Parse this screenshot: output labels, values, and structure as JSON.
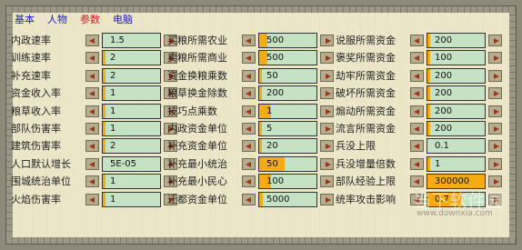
{
  "tabs": [
    {
      "label": "基本",
      "active": false
    },
    {
      "label": "人物",
      "active": false
    },
    {
      "label": "参数",
      "active": true
    },
    {
      "label": "电脑",
      "active": false
    }
  ],
  "columns": [
    {
      "rows": [
        {
          "label": "内政速率",
          "value": "1.5",
          "fill": 0
        },
        {
          "label": "训练速率",
          "value": "2",
          "fill": 0.05
        },
        {
          "label": "补充速率",
          "value": "2",
          "fill": 0.05
        },
        {
          "label": "资金收入率",
          "value": "1",
          "fill": 0.05
        },
        {
          "label": "粮草收入率",
          "value": "1",
          "fill": 0.05
        },
        {
          "label": "部队伤害率",
          "value": "1",
          "fill": 0.05
        },
        {
          "label": "建筑伤害率",
          "value": "2",
          "fill": 0.05
        },
        {
          "label": "人口默认增长",
          "value": "5E-05",
          "fill": 0
        },
        {
          "label": "围城统治单位",
          "value": "1",
          "fill": 0.05
        },
        {
          "label": "火焰伤害率",
          "value": "1",
          "fill": 0.05
        }
      ]
    },
    {
      "rows": [
        {
          "label": "买粮所需农业",
          "value": "500",
          "fill": 0.15
        },
        {
          "label": "卖粮所需商业",
          "value": "500",
          "fill": 0.15
        },
        {
          "label": "资金换粮乘数",
          "value": "50",
          "fill": 0.05
        },
        {
          "label": "粮草换金除数",
          "value": "200",
          "fill": 0.05
        },
        {
          "label": "技巧点乘数",
          "value": "1",
          "fill": 0.2
        },
        {
          "label": "内政资金单位",
          "value": "5",
          "fill": 0.05
        },
        {
          "label": "补充资金单位",
          "value": "20",
          "fill": 0.05
        },
        {
          "label": "补充最小统治",
          "value": "50",
          "fill": 0.45
        },
        {
          "label": "补充最小民心",
          "value": "100",
          "fill": 0.2
        },
        {
          "label": "迁都资金单位",
          "value": "5000",
          "fill": 0.07
        }
      ]
    },
    {
      "rows": [
        {
          "label": "说服所需资金",
          "value": "200",
          "fill": 0.05
        },
        {
          "label": "褒奖所需资金",
          "value": "100",
          "fill": 0.05
        },
        {
          "label": "劫牢所需资金",
          "value": "200",
          "fill": 0.05
        },
        {
          "label": "破坏所需资金",
          "value": "200",
          "fill": 0.05
        },
        {
          "label": "煽动所需资金",
          "value": "200",
          "fill": 0.05
        },
        {
          "label": "流言所需资金",
          "value": "200",
          "fill": 0.05
        },
        {
          "label": "兵没上限",
          "value": "0.1",
          "fill": 0
        },
        {
          "label": "兵没增量倍数",
          "value": "1",
          "fill": 0.05
        },
        {
          "label": "部队经验上限",
          "value": "300000",
          "fill": 1
        },
        {
          "label": "统率攻击影响",
          "value": "0.7",
          "fill": 0.6
        }
      ]
    }
  ],
  "colors": {
    "background": "#ece6c9",
    "field_bg": "#c6e2c4",
    "fill": "#f6ab12",
    "tab_active": "#c02020",
    "tab_inactive": "#1b1bb0"
  },
  "icons": {
    "decrease": "arrow-left-icon",
    "increase": "arrow-right-icon"
  },
  "watermark": {
    "main": "当下软件园",
    "sub": "www.downxia.com"
  }
}
